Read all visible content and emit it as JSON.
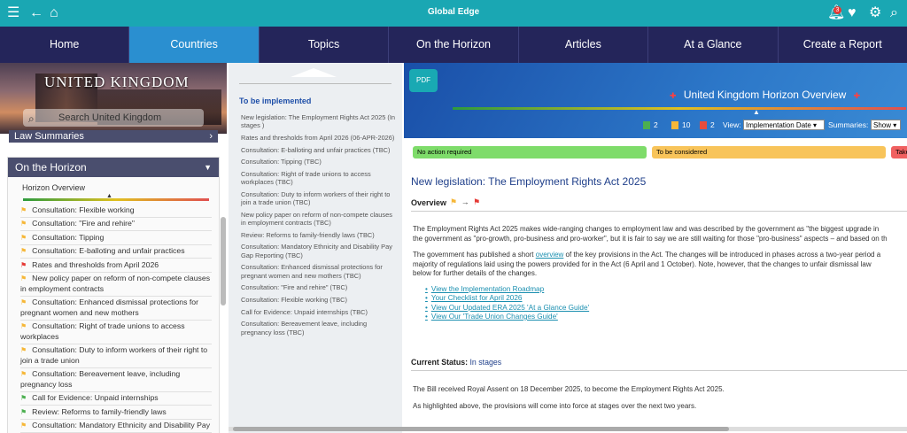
{
  "app": {
    "title": "Global Edge",
    "notifications": "3"
  },
  "nav": {
    "tabs": [
      "Home",
      "Countries",
      "Topics",
      "On the Horizon",
      "Articles",
      "At a Glance",
      "Create a Report"
    ],
    "active": 1
  },
  "left": {
    "banner_title": "UNITED KINGDOM",
    "search_placeholder": "Search United Kingdom",
    "law_summaries": "Law Summaries",
    "horizon_header": "On the Horizon",
    "horizon_overview": "Horizon Overview",
    "items": [
      {
        "label": "Consultation: Flexible working",
        "status": "orange"
      },
      {
        "label": "Consultation: \"Fire and rehire\"",
        "status": "orange"
      },
      {
        "label": "Consultation: Tipping",
        "status": "orange"
      },
      {
        "label": "Consultation: E-balloting and unfair practices",
        "status": "orange"
      },
      {
        "label": "Rates and thresholds from April 2026",
        "status": "red"
      },
      {
        "label": "New policy paper on reform of non-compete clauses in employment contracts",
        "status": "orange"
      },
      {
        "label": "Consultation: Enhanced dismissal protections for pregnant women and new mothers",
        "status": "orange"
      },
      {
        "label": "Consultation: Right of trade unions to access workplaces",
        "status": "orange"
      },
      {
        "label": "Consultation: Duty to inform workers of their right to join a trade union",
        "status": "orange"
      },
      {
        "label": "Consultation: Bereavement leave, including pregnancy loss",
        "status": "orange"
      },
      {
        "label": "Call for Evidence: Unpaid internships",
        "status": "green"
      },
      {
        "label": "Review: Reforms to family-friendly laws",
        "status": "green"
      },
      {
        "label": "Consultation: Mandatory Ethnicity and Disability Pay",
        "status": "orange"
      }
    ]
  },
  "middle": {
    "heading": "To be implemented",
    "items": [
      "New legislation: The Employment Rights Act 2025 (In stages )",
      "Rates and thresholds from April 2026 (06-APR-2026)",
      "Consultation: E-balloting and unfair practices (TBC)",
      "Consultation: Tipping (TBC)",
      "Consultation: Right of trade unions to access workplaces (TBC)",
      "Consultation: Duty to inform workers of their right to join a trade union (TBC)",
      "New policy paper on reform of non-compete clauses in employment contracts (TBC)",
      "Review: Reforms to family-friendly laws (TBC)",
      "Consultation: Mandatory Ethnicity and Disability Pay Gap Reporting (TBC)",
      "Consultation: Enhanced dismissal protections for pregnant women and new mothers (TBC)",
      "Consultation: \"Fire and rehire\" (TBC)",
      "Consultation: Flexible working (TBC)",
      "Call for Evidence: Unpaid internships (TBC)",
      "Consultation: Bereavement leave, including pregnancy loss (TBC)"
    ]
  },
  "right": {
    "pdf": "PDF",
    "overview_title": "United Kingdom Horizon Overview",
    "counts": {
      "green": "2",
      "orange": "10",
      "red": "2"
    },
    "view_label": "View:",
    "view_value": "Implementation Date",
    "summaries_label": "Summaries:",
    "summaries_value": "Show",
    "status_bars": [
      "No action required",
      "To be considered",
      "Take"
    ],
    "colors": {
      "green": "#7edc6a",
      "orange": "#f8c45a",
      "red": "#f06060"
    },
    "headline": "New legislation: The Employment Rights Act 2025",
    "overview_label": "Overview",
    "p1a": "The Employment Rights Act 2025 makes wide-ranging changes to employment law and was described by the government as \"the biggest upgrade in",
    "p1b": "the government as \"pro-growth, pro-business and pro-worker\", but it is fair to say we are still waiting for those \"pro-business\" aspects – and based on th",
    "p2a_pre": "The government has published a short ",
    "p2a_link": "overview",
    "p2a_post": " of the key provisions in the Act.  The changes will be introduced in phases across a two-year period a",
    "p2b": "majority of regulations laid using the powers provided for in the Act (6 April and 1 October).  Note, however, that the changes to unfair dismissal law",
    "p2c": "below for further details of the changes.",
    "links": [
      "View the Implementation Roadmap",
      "Your Checklist for April 2026",
      "View Our Updated ERA 2025 'At a Glance Guide'",
      "View Our 'Trade Union Changes Guide'"
    ],
    "current_status_label": "Current Status:",
    "current_status_value": "In stages",
    "p3": "The Bill received Royal Assent on 18 December 2025, to become the Employment Rights Act 2025.",
    "p4": "As highlighted above, the provisions will come into force at stages over the next two years."
  }
}
